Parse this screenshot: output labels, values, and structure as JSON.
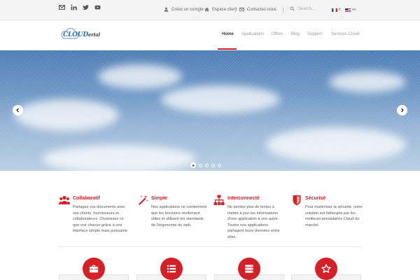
{
  "topbar": {
    "social": [
      "email-icon",
      "linkedin-icon",
      "twitter-icon",
      "youtube-icon"
    ],
    "create_account": "Créez un compte",
    "client_space": "Espace client",
    "contact": "Contactez-nous",
    "search_placeholder": "Search...",
    "lang_fr": "fr",
    "lang_en": "en"
  },
  "logo": {
    "text_main": "CLOUD",
    "text_sub": "erial",
    "icon": "cloud-logo"
  },
  "nav": {
    "items": [
      "Home",
      "Applications",
      "Offres",
      "Blog",
      "Support",
      "Services Cloud"
    ],
    "active": "Home"
  },
  "hero": {
    "prev_icon": "chevron-left-icon",
    "next_icon": "chevron-right-icon",
    "slide_count": 5,
    "play_icon": "play-icon"
  },
  "features": [
    {
      "icon": "users-icon",
      "title": "Collaboratif",
      "text": "Partagez vos documents avec vos clients, fournisseurs et collaborateurs. Choisissez ce que voir chacun grâce à une interface simple mais puissante"
    },
    {
      "icon": "magic-wand-icon",
      "title": "Simple",
      "text": "Nos applications ne contiennent que les fonctions réellement utiles et utilisent les standards de l'ergonomie du web."
    },
    {
      "icon": "sitemap-icon",
      "title": "Interconnecté",
      "text": "Ne perdez plus de temps à mettre à jour les informations d'une application à une autre. Toutes nos applications partagent leurs données entre elles."
    },
    {
      "icon": "shield-icon",
      "title": "Sécurisé",
      "text": "Pour maximiser la sécurité, notre solution est hébergée par les meilleurs prestataires Cloud du marché."
    }
  ],
  "cards": [
    "briefcase-icon",
    "list-icon",
    "server-icon",
    "star-icon"
  ],
  "colors": {
    "accent": "#d42027",
    "link": "#2a6fb5"
  }
}
